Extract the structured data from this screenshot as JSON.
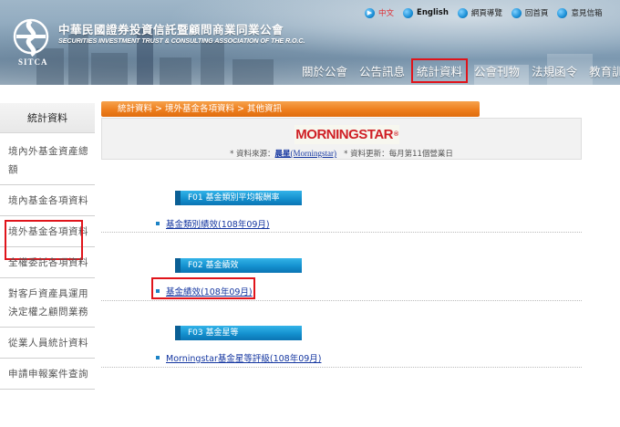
{
  "header": {
    "org_zh": "中華民國證券投資信託暨顧問商業同業公會",
    "org_en": "SECURITIES INVESTMENT TRUST & CONSULTING ASSOCIATION OF THE R.O.C.",
    "logo_text": "SITCA",
    "top_links": [
      {
        "label": "中文",
        "active": true
      },
      {
        "label": "English",
        "active": false
      },
      {
        "label": "網頁導覽",
        "active": false
      },
      {
        "label": "回首頁",
        "active": false
      },
      {
        "label": "意見信箱",
        "active": false
      }
    ],
    "nav": [
      "關於公會",
      "公告訊息",
      "統計資料",
      "公會刊物",
      "法規函令",
      "教育訓練"
    ],
    "nav_highlight_index": 2
  },
  "sidebar": {
    "title": "統計資料",
    "items": [
      "境內外基金資產總額",
      "境內基金各項資料",
      "境外基金各項資料",
      "全權委託各項資料",
      "對客戶資產具運用決定權之顧問業務",
      "從業人員統計資料",
      "申請申報案件查詢"
    ],
    "highlight_index": 2
  },
  "breadcrumb": "統計資料 > 境外基金各項資料 > 其他資訊",
  "source": {
    "logo": "MORNINGSTAR",
    "registered": "®",
    "prefix": "* 資料來源：",
    "name_zh": "晨星",
    "name_en": "(Morningstar)",
    "update": "* 資料更新：每月第11個營業日"
  },
  "sections": [
    {
      "header": "F01 基金類別平均報酬率",
      "link": "基金類別績效(108年09月)"
    },
    {
      "header": "F02 基金績效",
      "link": "基金績效(108年09月)"
    },
    {
      "header": "F03 基金星等",
      "link": "Morningstar基金星等評級(108年09月)"
    }
  ],
  "colors": {
    "highlight_box": "#e0141b",
    "breadcrumb_orange": "#ee7f1e",
    "section_blue": "#1491cf",
    "link_blue": "#1436a0"
  }
}
